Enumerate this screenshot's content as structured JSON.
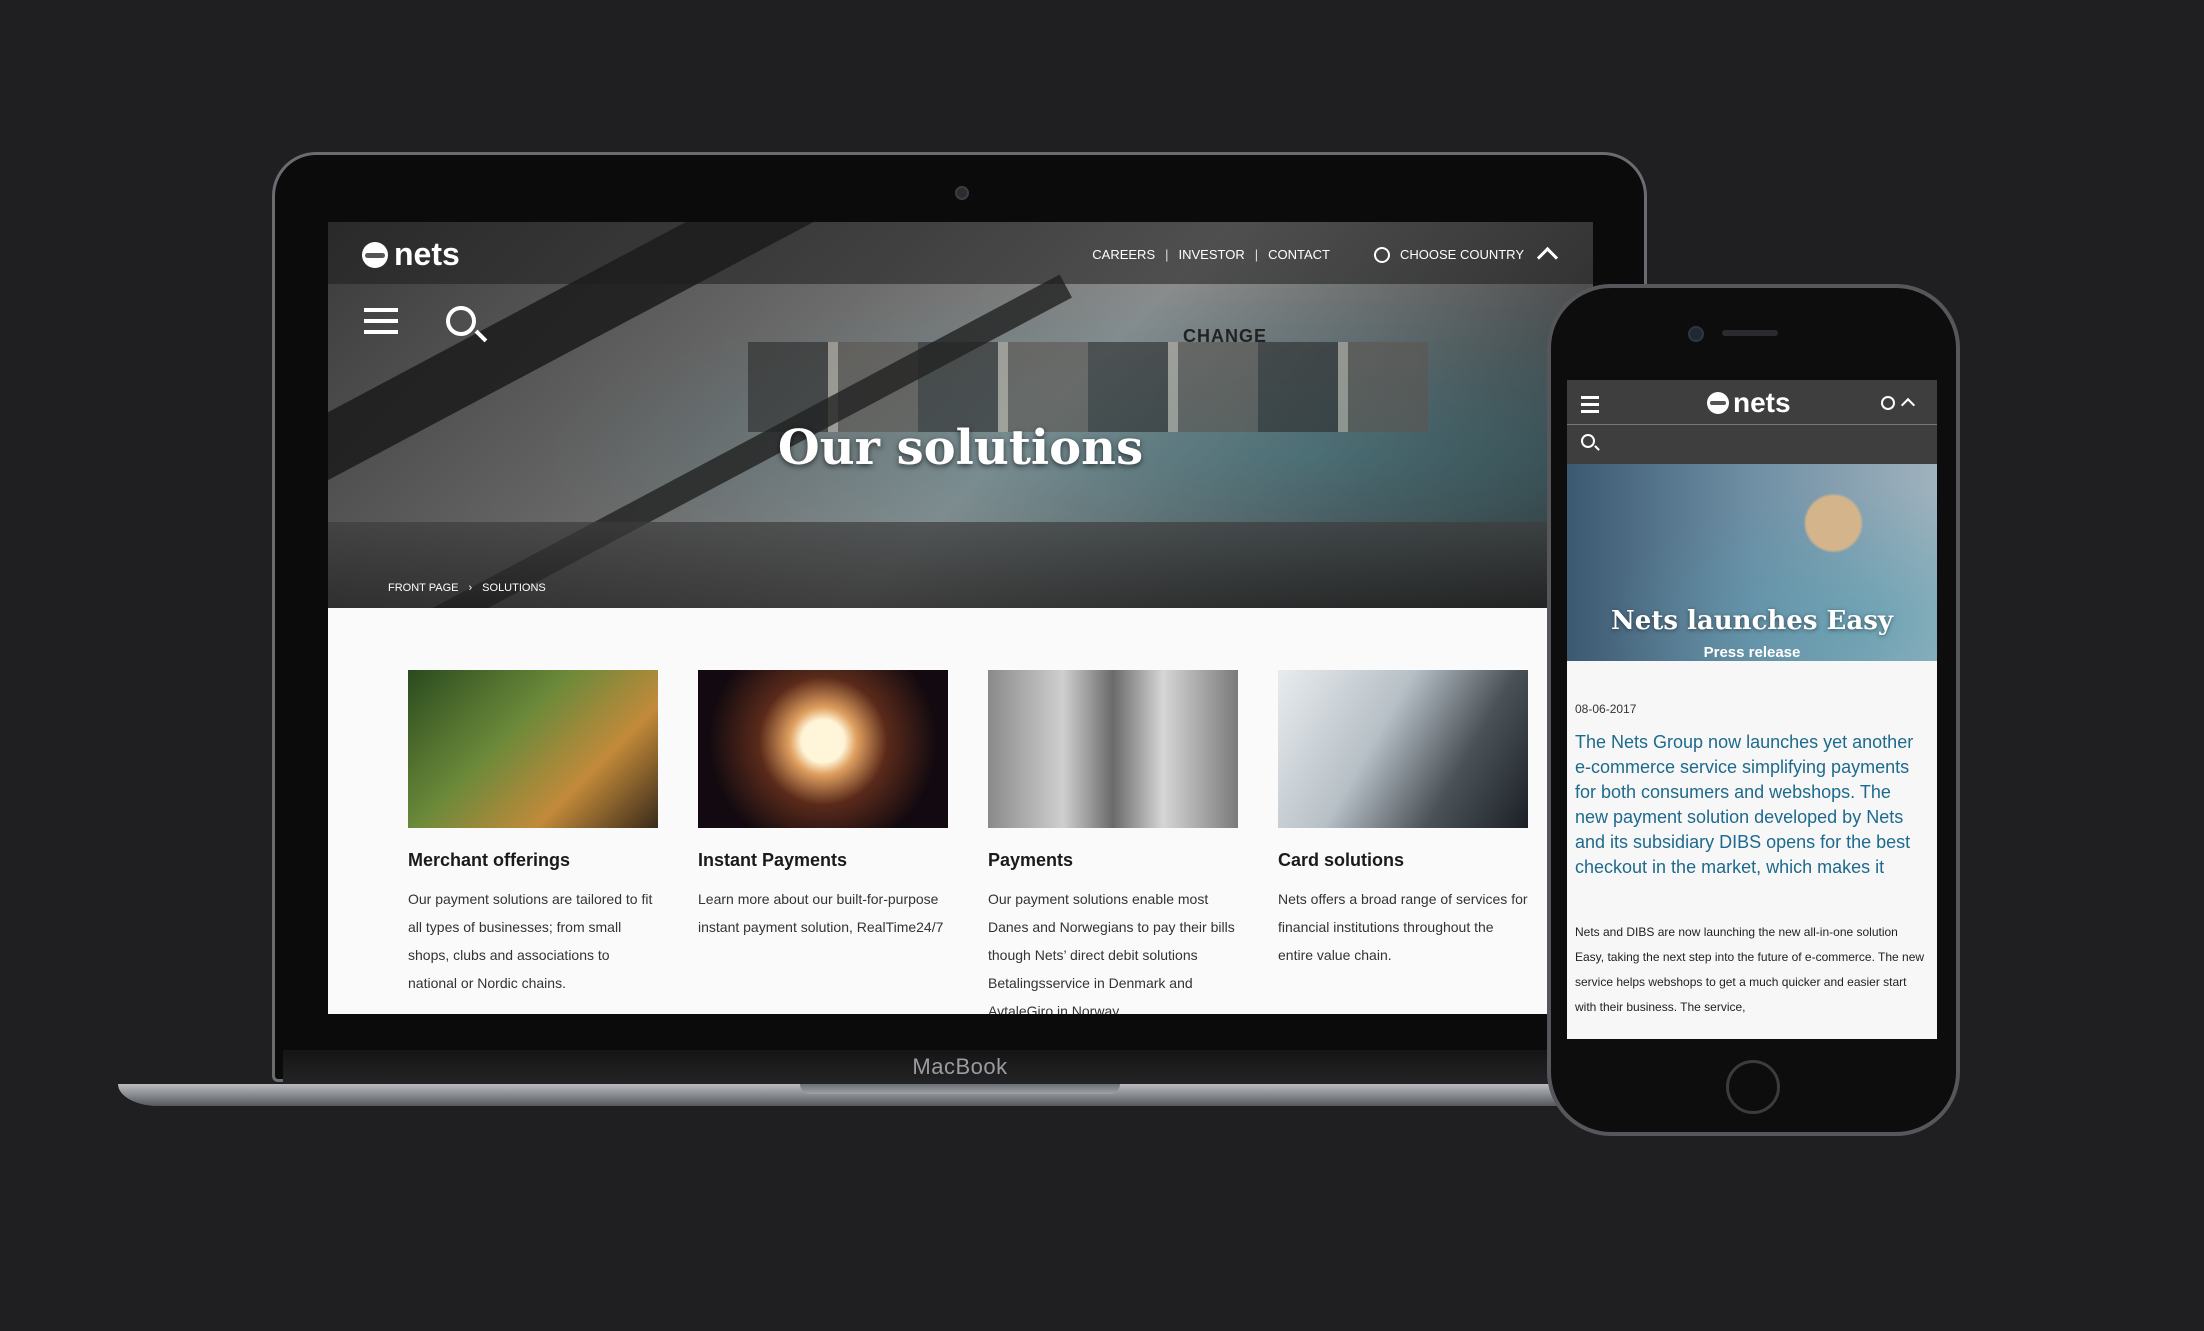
{
  "desktop": {
    "logo": "nets",
    "nav": {
      "careers": "CAREERS",
      "investor": "INVESTOR",
      "contact": "CONTACT",
      "country": "CHOOSE COUNTRY"
    },
    "hero_title": "Our solutions",
    "hero_sign": "CHANGE",
    "breadcrumb": {
      "home": "FRONT PAGE",
      "current": "SOLUTIONS"
    },
    "cards": [
      {
        "title": "Merchant offerings",
        "text": "Our payment solutions are tailored to fit all types of businesses; from small shops, clubs and associations to national or Nordic chains."
      },
      {
        "title": "Instant Payments",
        "text": "Learn more about our built-for-purpose instant payment solution, RealTime24/7"
      },
      {
        "title": "Payments",
        "text": "Our payment solutions enable most Danes and Norwegians to pay their bills though Nets’ direct debit solutions Betalingsservice in Denmark and AvtaleGiro in Norway."
      },
      {
        "title": "Card solutions",
        "text": "Nets offers a broad range of services for financial institutions throughout the entire value chain."
      }
    ]
  },
  "laptop_brand": "MacBook",
  "mobile": {
    "logo": "nets",
    "hero_title": "Nets launches Easy",
    "hero_subtitle": "Press release",
    "date": "08-06-2017",
    "lead": "The Nets Group now launches yet another e-commerce service simplifying payments for both consumers and webshops. The new payment solution developed by Nets and its subsidiary DIBS opens for the best checkout in the market, which makes it",
    "body": "Nets and DIBS are now launching the new all-in-one solution Easy, taking the next step into the future of e-commerce. The new service helps webshops to get a much quicker and easier start with their business. The service,"
  },
  "colors": {
    "background": "#1f1f21",
    "mobile_lead": "#1d6a8e",
    "page_bg": "#fafafa"
  },
  "icons": [
    "menu-icon",
    "search-icon",
    "globe-icon",
    "chevron-up-icon",
    "nets-logo-icon"
  ]
}
